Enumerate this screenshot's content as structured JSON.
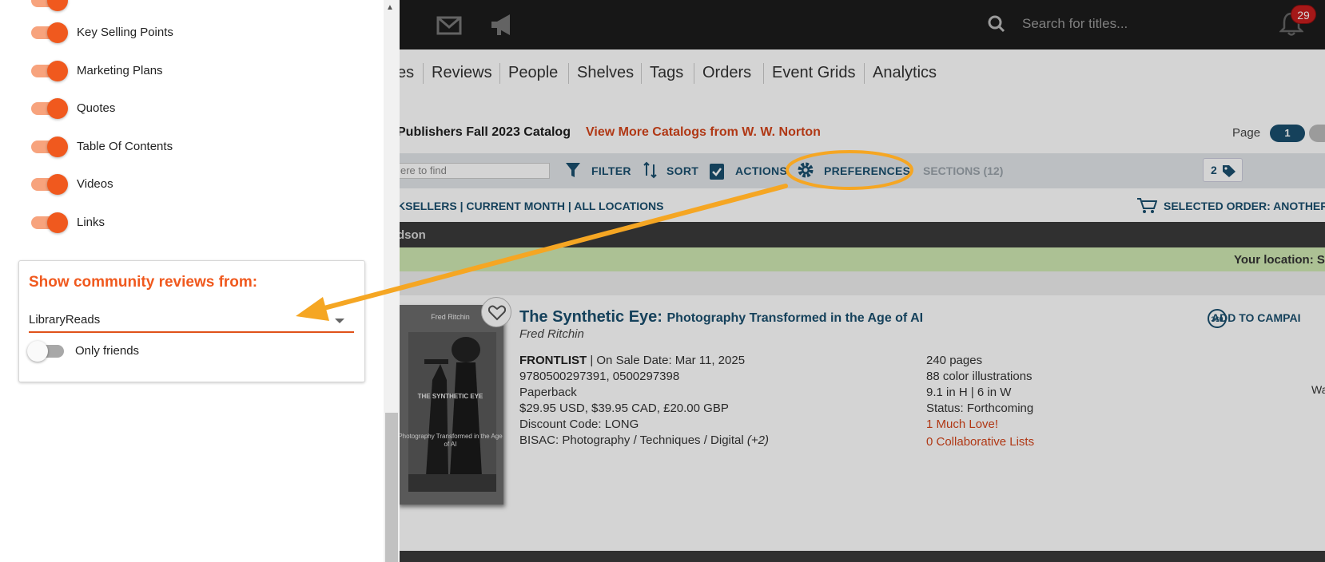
{
  "topbar": {
    "search_placeholder": "Search for titles...",
    "notifications_count": "29"
  },
  "nav": {
    "partial_first": "es",
    "items": [
      "Reviews",
      "People",
      "Shelves",
      "Tags",
      "Orders",
      "Event Grids",
      "Analytics"
    ]
  },
  "catalog": {
    "title": "Publishers Fall 2023 Catalog",
    "more_link": "View More Catalogs from W. W. Norton",
    "page_label": "Page",
    "page_current": "1"
  },
  "toolbar": {
    "find_placeholder": "ere to find",
    "filter": "FILTER",
    "sort": "SORT",
    "actions": "ACTIONS",
    "preferences": "PREFERENCES",
    "sections": "SECTIONS (12)",
    "tag_count": "2"
  },
  "filters": {
    "text": "KSELLERS | CURRENT MONTH | ALL LOCATIONS",
    "selected_order": "SELECTED ORDER: ANOTHER C"
  },
  "rows": {
    "dark_label": "dson",
    "location_label": "Your location: S"
  },
  "book": {
    "cover_author": "Fred Ritchin",
    "cover_title": "THE SYNTHETIC EYE",
    "cover_subtitle": "Photography Transformed in the Age of AI",
    "title": "The Synthetic Eye:",
    "subtitle": "Photography Transformed in the Age of AI",
    "author": "Fred Ritchin",
    "frontlist": "FRONTLIST",
    "on_sale": "| On Sale Date: Mar 11, 2025",
    "isbns": "9780500297391, 0500297398",
    "format": "Paperback",
    "price": "$29.95 USD, $39.95 CAD, £20.00 GBP",
    "discount": "Discount Code: LONG",
    "bisac": "BISAC: Photography / Techniques / Digital",
    "bisac_more": "(+2)",
    "pages": "240 pages",
    "illustrations": "88 color illustrations",
    "dimensions": "9.1 in H | 6 in W",
    "status": "Status: Forthcoming",
    "loves": "1 Much Love!",
    "lists": "0 Collaborative Lists",
    "add_campaign": "ADD TO CAMPAI",
    "wa_text": "Wa"
  },
  "panel": {
    "toggles": [
      {
        "label": "Key Selling Points",
        "on": true
      },
      {
        "label": "Marketing Plans",
        "on": true
      },
      {
        "label": "Quotes",
        "on": true
      },
      {
        "label": "Table Of Contents",
        "on": true
      },
      {
        "label": "Videos",
        "on": true
      },
      {
        "label": "Links",
        "on": true
      }
    ],
    "community": {
      "title": "Show community reviews from:",
      "selected": "LibraryReads",
      "only_friends_label": "Only friends",
      "only_friends_on": false
    }
  },
  "colors": {
    "accent_orange": "#f0591e",
    "annotation": "#f5a623",
    "nav_blue": "#1a4f6e",
    "link_orange": "#d4441a"
  }
}
